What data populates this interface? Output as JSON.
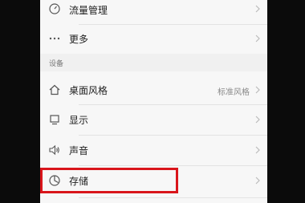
{
  "items": [
    {
      "label": "流量管理",
      "icon": "traffic-gauge-icon"
    },
    {
      "label": "更多",
      "icon": "more-dots-icon"
    }
  ],
  "section_title": "设备",
  "device_items": [
    {
      "label": "桌面风格",
      "value": "标准风格",
      "icon": "home-icon"
    },
    {
      "label": "显示",
      "icon": "display-icon"
    },
    {
      "label": "声音",
      "icon": "speaker-icon"
    },
    {
      "label": "存储",
      "icon": "storage-pie-icon"
    }
  ],
  "colors": {
    "highlight": "#d9151b",
    "background": "#f7f7f7"
  }
}
